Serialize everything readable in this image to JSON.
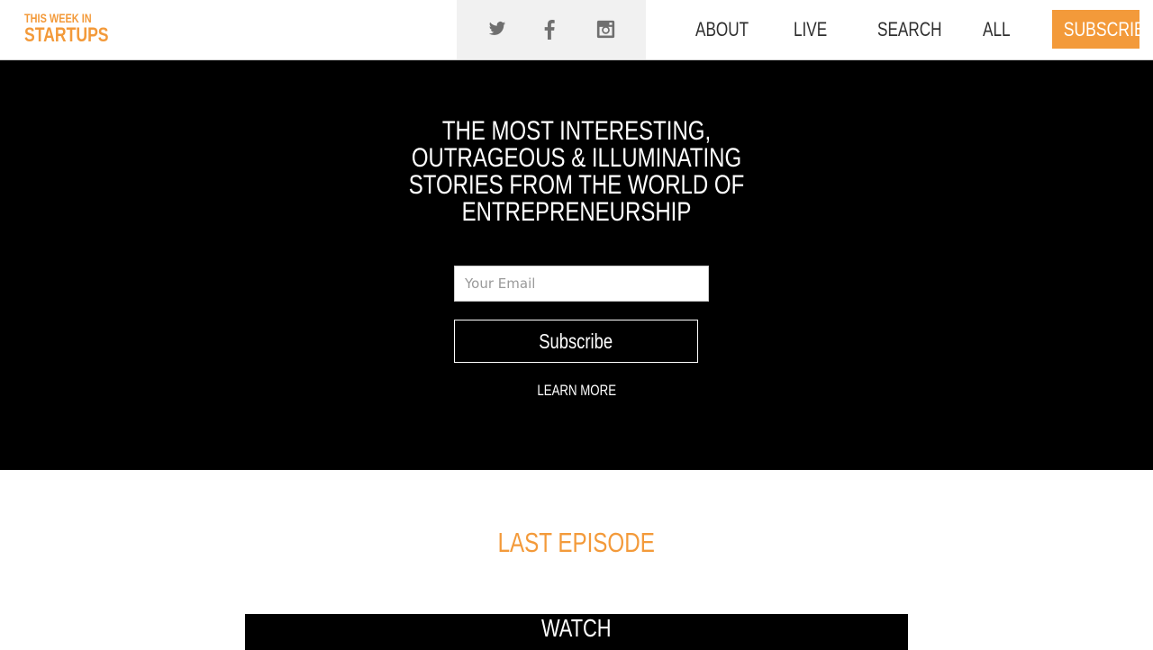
{
  "header": {
    "logo_line1": "THIS WEEK IN",
    "logo_line2": "STARTUPS",
    "social": [
      {
        "name": "twitter-icon"
      },
      {
        "name": "facebook-icon"
      },
      {
        "name": "instagram-icon"
      }
    ],
    "nav": [
      "About",
      "Live",
      "Search",
      "All"
    ],
    "subscribe_label": "Subscribe"
  },
  "hero": {
    "headline": "THE MOST INTERESTING, OUTRAGEOUS & ILLUMINATING STORIES FROM THE WORLD OF ENTREPRENEURSHIP",
    "email_placeholder": "Your Email",
    "email_value": "",
    "subscribe_label": "Subscribe",
    "learn_more": "Learn More"
  },
  "last_episode": {
    "title": "Last Episode",
    "watch_label": "Watch"
  },
  "colors": {
    "accent": "#f39a3a",
    "hero_bg": "#000000",
    "social_bg": "#f1f1f1"
  }
}
